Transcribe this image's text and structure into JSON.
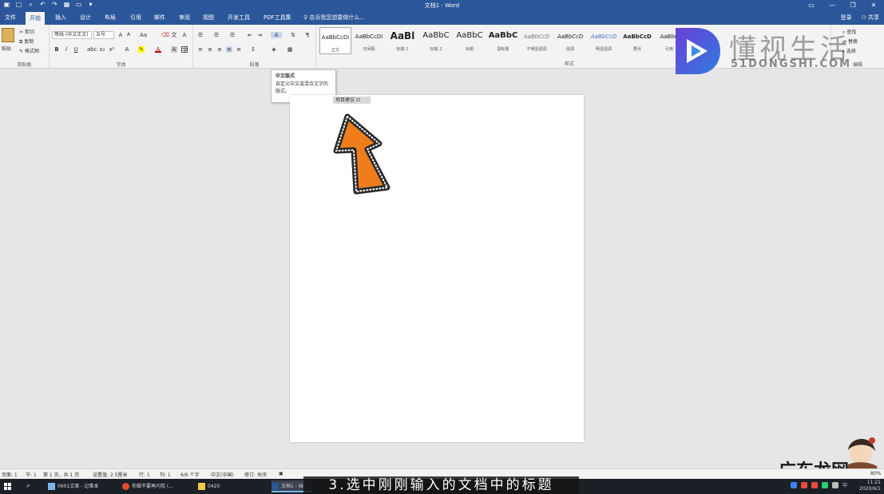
{
  "titlebar": {
    "doc_title": "文档1 - Word",
    "qat_icons": [
      "save-icon",
      "new-icon",
      "print-preview-icon",
      "undo-icon",
      "redo-icon",
      "table-icon",
      "folder-icon",
      "customize-icon"
    ]
  },
  "tabs": {
    "file": "文件",
    "home": "开始",
    "insert": "插入",
    "design": "设计",
    "layout": "布局",
    "references": "引用",
    "mailings": "邮件",
    "review": "审阅",
    "view": "视图",
    "developer": "开发工具",
    "pdf": "PDF工具集",
    "tell_me": "告诉我您想要做什么...",
    "signin": "登录",
    "share": "共享"
  },
  "ribbon": {
    "clipboard": {
      "paste": "粘贴",
      "cut": "剪切",
      "copy": "复制",
      "format_painter": "格式刷",
      "label": "剪贴板"
    },
    "font": {
      "font_name": "等线 (中文正文)",
      "font_size": "五号",
      "label": "字体"
    },
    "paragraph": {
      "label": "段落"
    },
    "styles": {
      "label": "样式",
      "items": [
        {
          "preview": "AaBbCcDi",
          "name": "正文"
        },
        {
          "preview": "AaBbCcDi",
          "name": "无间隔"
        },
        {
          "preview": "AaBl",
          "name": "标题 1"
        },
        {
          "preview": "AaBbC",
          "name": "标题 2"
        },
        {
          "preview": "AaBbC",
          "name": "标题"
        },
        {
          "preview": "AaBbC",
          "name": "副标题"
        },
        {
          "preview": "AaBbCcD",
          "name": "不明显强调"
        },
        {
          "preview": "AaBbCcD",
          "name": "强调"
        },
        {
          "preview": "AaBbCcD",
          "name": "明显强调"
        },
        {
          "preview": "AaBbCcD",
          "name": "要点"
        },
        {
          "preview": "AaBbC",
          "name": "引用"
        }
      ]
    },
    "editing": {
      "find": "查找",
      "replace": "替换",
      "select": "选择",
      "label": "编辑"
    }
  },
  "tooltip": {
    "title": "中文版式",
    "body": "自定义中文或混合文字的版式。"
  },
  "mini_toolbar": {
    "label": "项目建议"
  },
  "watermark": {
    "cn": "懂视生活",
    "en": "51DONGSHI.COM",
    "brand_bottom": "广东龙网"
  },
  "statusbar": {
    "page": "页面: 1",
    "section": "节: 1",
    "page_of": "第 1 页，共 1 页",
    "position": "设置值: 2.5厘米",
    "line": "行: 1",
    "column": "列: 1",
    "words": "6/6 个字",
    "language": "中文(中国)",
    "track_changes": "修订: 关闭",
    "zoom": "80%"
  },
  "taskbar": {
    "items": [
      {
        "label": "0601文案 - 记事本"
      },
      {
        "label": "你做不要再问我 (..."
      },
      {
        "label": "0420"
      },
      {
        "label": "文档1 - W..."
      }
    ],
    "time": "11:21",
    "date": "2020/6/1",
    "ime": "中"
  },
  "caption": "3.选中刚刚输入的文档中的标题",
  "colors": {
    "word_blue": "#2b579a",
    "arrow_orange": "#f07d1c"
  }
}
